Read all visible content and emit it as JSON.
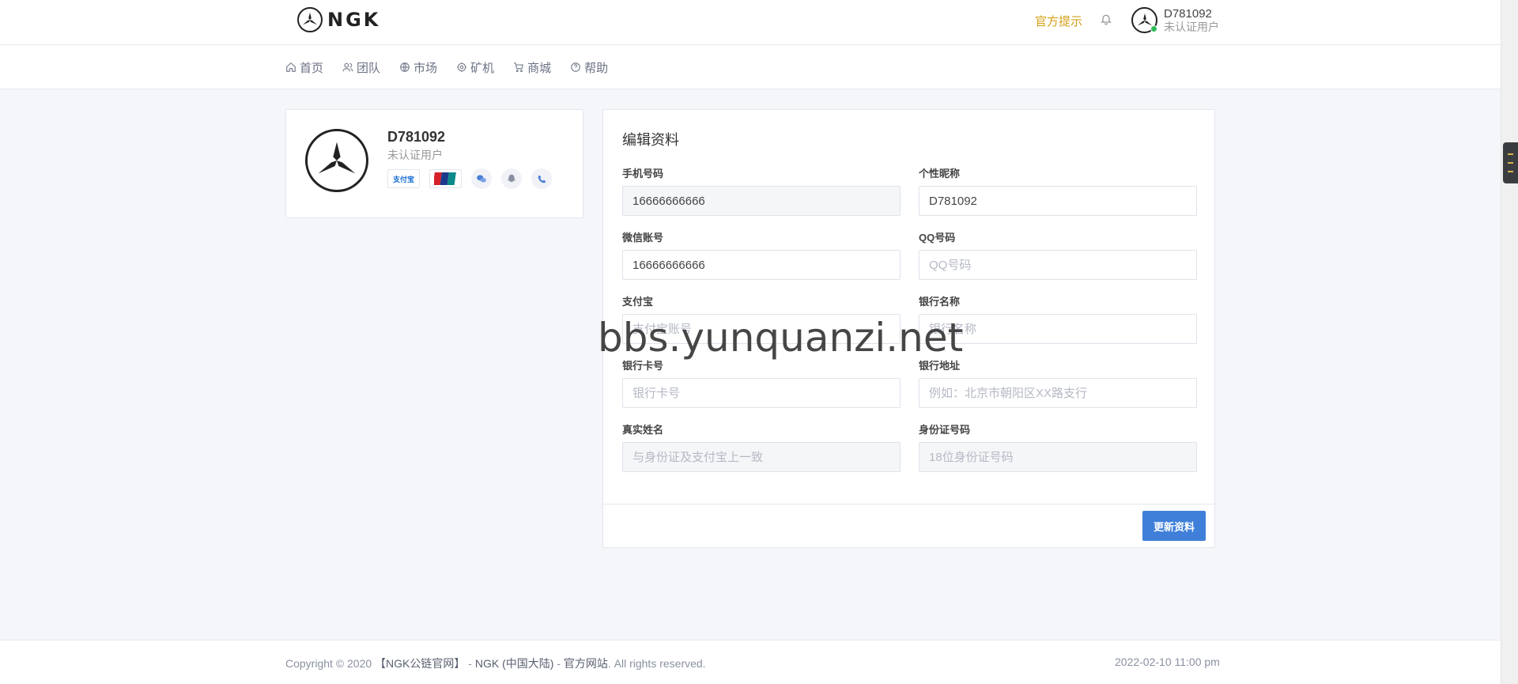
{
  "header": {
    "logo_text": "NGK",
    "official_tip": "官方提示",
    "user": {
      "name": "D781092",
      "role": "未认证用户"
    }
  },
  "nav": {
    "items": [
      {
        "label": "首页",
        "icon": "home-icon"
      },
      {
        "label": "团队",
        "icon": "users-icon"
      },
      {
        "label": "市场",
        "icon": "globe-icon"
      },
      {
        "label": "矿机",
        "icon": "gear-icon"
      },
      {
        "label": "商城",
        "icon": "cart-icon"
      },
      {
        "label": "帮助",
        "icon": "help-icon"
      }
    ]
  },
  "profile": {
    "name": "D781092",
    "role": "未认证用户",
    "badges": [
      "alipay-icon",
      "unionpay-icon",
      "wechat-icon",
      "qq-icon",
      "phone-icon"
    ],
    "alipay_text": "支付宝"
  },
  "edit": {
    "title": "编辑资料",
    "fields": {
      "phone": {
        "label": "手机号码",
        "value": "16666666666",
        "placeholder": ""
      },
      "nickname": {
        "label": "个性昵称",
        "value": "D781092",
        "placeholder": ""
      },
      "wechat": {
        "label": "微信账号",
        "value": "16666666666",
        "placeholder": ""
      },
      "qq": {
        "label": "QQ号码",
        "value": "",
        "placeholder": "QQ号码"
      },
      "alipay": {
        "label": "支付宝",
        "value": "",
        "placeholder": "支付宝账号"
      },
      "bank_name": {
        "label": "银行名称",
        "value": "",
        "placeholder": "银行名称"
      },
      "bank_card": {
        "label": "银行卡号",
        "value": "",
        "placeholder": "银行卡号"
      },
      "bank_address": {
        "label": "银行地址",
        "value": "",
        "placeholder": "例如：北京市朝阳区XX路支行"
      },
      "real_name": {
        "label": "真实姓名",
        "value": "",
        "placeholder": "与身份证及支付宝上一致"
      },
      "id_number": {
        "label": "身份证号码",
        "value": "",
        "placeholder": "18位身份证号码"
      }
    },
    "submit_label": "更新资料"
  },
  "footer": {
    "copyright_prefix": "Copyright © 2020",
    "site_name": "【NGK公链官网】",
    "sep1": " - ",
    "brand": "NGK (中国大陆)",
    "sep2": " - ",
    "official": "官方网站",
    "suffix": ". All rights reserved.",
    "datetime": "2022-02-10 11:00 pm"
  },
  "watermark": "bbs.yunquanzi.net",
  "colors": {
    "accent": "#3f7fd9",
    "tip": "#d4a017",
    "online": "#2ebd59"
  }
}
